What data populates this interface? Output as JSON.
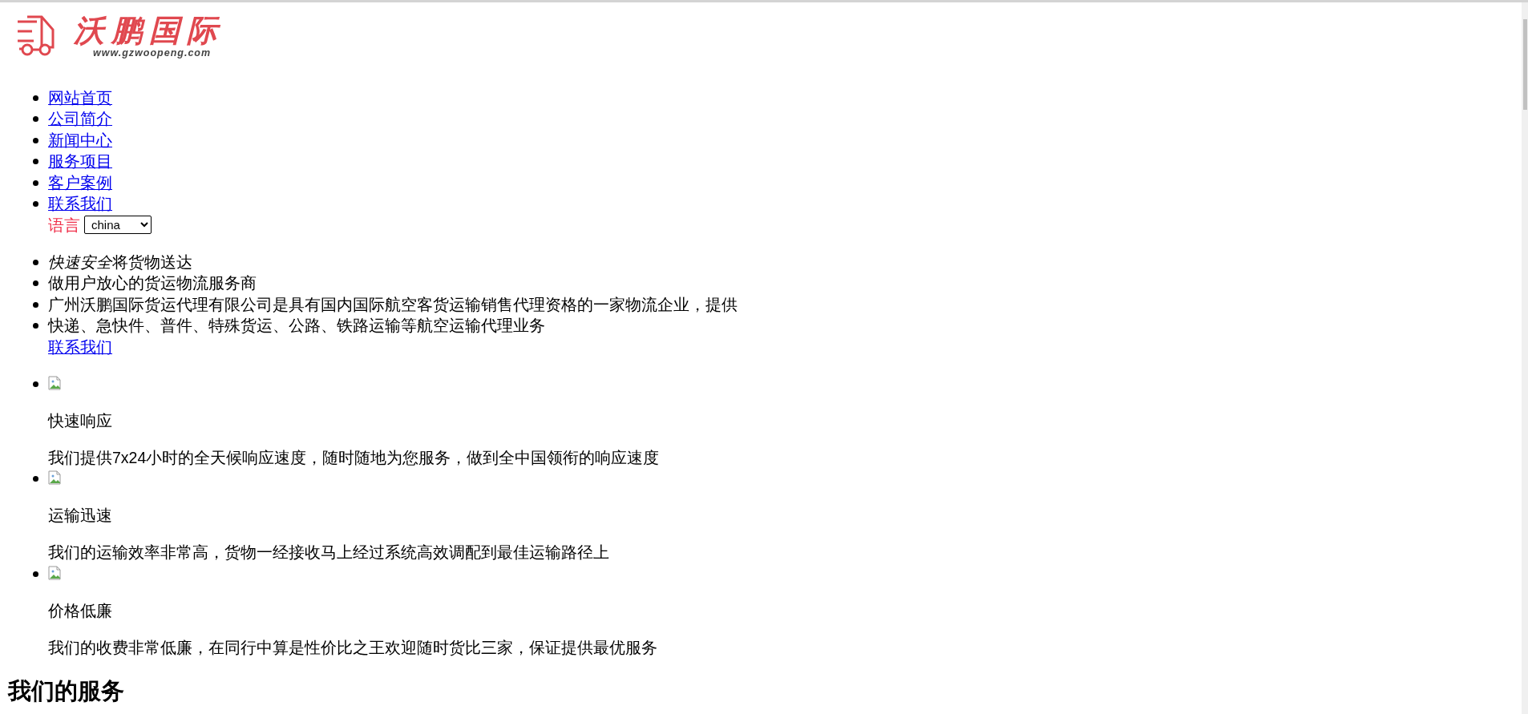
{
  "logo": {
    "name": "沃鹏国际",
    "url": "www.gzwoopeng.com"
  },
  "nav": {
    "items": [
      "网站首页",
      "公司简介",
      "新闻中心",
      "服务项目",
      "客户案例",
      "联系我们"
    ],
    "language": {
      "label": "语言",
      "value": "china"
    }
  },
  "taglines": {
    "items": [
      [
        {
          "text": "快速安全",
          "italic": true
        },
        {
          "text": "将货物送达",
          "italic": false
        }
      ],
      "做用户放心的货运物流服务商",
      "广州沃鹏国际货运代理有限公司是具有国内国际航空客货运输销售代理资格的一家物流企业，提供",
      "快递、急快件、普件、特殊货运、公路、铁路运输等航空运输代理业务"
    ],
    "link": "联系我们"
  },
  "features": [
    {
      "title": "快速响应",
      "description": "我们提供7x24小时的全天候响应速度，随时随地为您服务，做到全中国领衔的响应速度"
    },
    {
      "title": "运输迅速",
      "description": "我们的运输效率非常高，货物一经接收马上经过系统高效调配到最佳运输路径上"
    },
    {
      "title": "价格低廉",
      "description": "我们的收费非常低廉，在同行中算是性价比之王欢迎随时货比三家，保证提供最优服务"
    }
  ],
  "section_heading": "我们的服务"
}
